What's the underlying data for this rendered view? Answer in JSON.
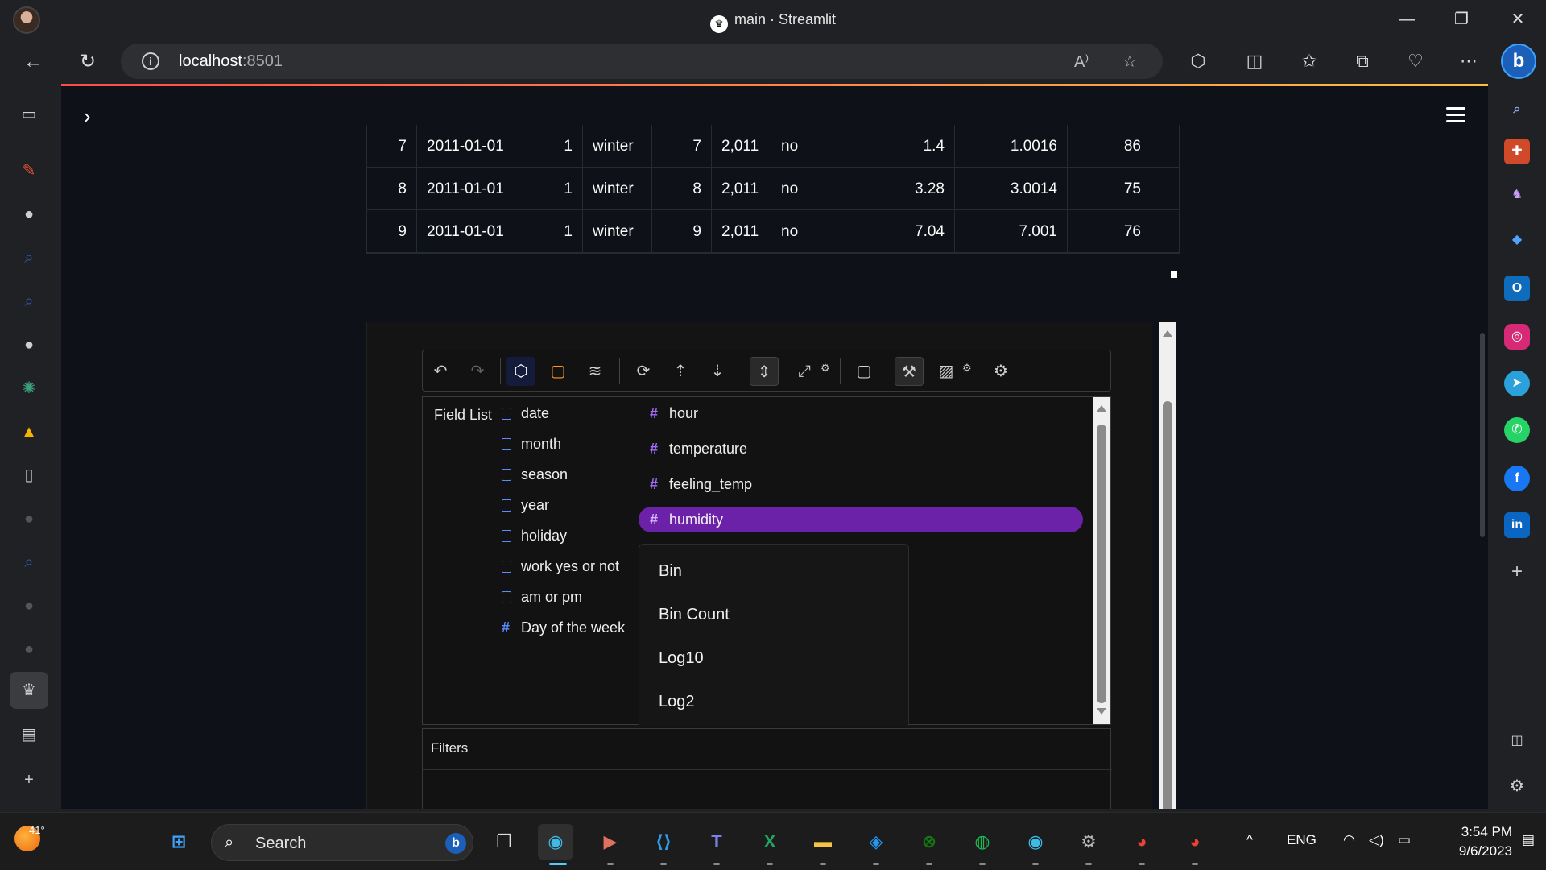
{
  "window": {
    "title": "main · Streamlit"
  },
  "browser": {
    "url_host": "localhost",
    "url_port": ":8501"
  },
  "table": {
    "rows": [
      [
        "7",
        "2011-01-01",
        "1",
        "winter",
        "7",
        "2,011",
        "no",
        "1.4",
        "1.0016",
        "86"
      ],
      [
        "8",
        "2011-01-01",
        "1",
        "winter",
        "8",
        "2,011",
        "no",
        "3.28",
        "3.0014",
        "75"
      ],
      [
        "9",
        "2011-01-01",
        "1",
        "winter",
        "9",
        "2,011",
        "no",
        "7.04",
        "7.001",
        "76"
      ]
    ]
  },
  "field_list": {
    "title": "Field List",
    "dimensions": [
      "date",
      "month",
      "season",
      "year",
      "holiday",
      "work yes or not",
      "am or pm",
      "Day of the week"
    ],
    "measures": [
      "hour",
      "temperature",
      "feeling_temp",
      "humidity"
    ],
    "context_menu": [
      "Bin",
      "Bin Count",
      "Log10",
      "Log2"
    ]
  },
  "filters": {
    "label": "Filters"
  },
  "taskbar": {
    "weather_temp": "41°",
    "search_label": "Search",
    "language": "ENG",
    "time": "3:54 PM",
    "date": "9/6/2023"
  },
  "colors": {
    "streamlit_bg": "#0e1117",
    "highlight_purple": "#6b21a8",
    "dimension_blue": "#5a8cff",
    "measure_purple": "#a66bff",
    "accent_gradient_start": "#ff4b4b",
    "accent_gradient_end": "#ffbd45"
  },
  "icons": {
    "toolbar": [
      "undo-icon",
      "redo-icon",
      "cube-icon",
      "paint-bucket-icon",
      "layers-icon",
      "refresh-icon",
      "sort-ascending-icon",
      "sort-descending-icon",
      "expand-collapse-icon",
      "fullscreen-icon",
      "gear-icon",
      "shape-icon",
      "wrench-icon",
      "image-icon",
      "gear-icon",
      "settings-icon"
    ]
  }
}
